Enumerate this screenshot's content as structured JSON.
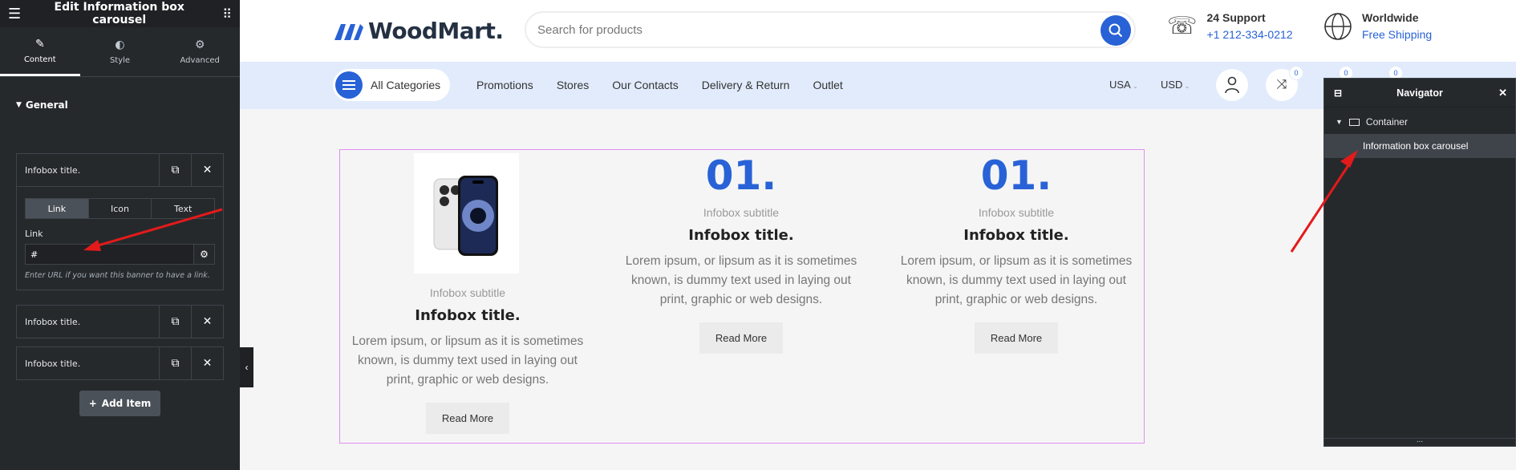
{
  "panel": {
    "title": "Edit Information box carousel",
    "tabs": [
      {
        "label": "Content"
      },
      {
        "label": "Style"
      },
      {
        "label": "Advanced"
      }
    ],
    "section": "General",
    "items": [
      {
        "label": "Infobox title."
      },
      {
        "label": "Infobox title."
      },
      {
        "label": "Infobox title."
      }
    ],
    "segments": [
      "Link",
      "Icon",
      "Text"
    ],
    "link_label": "Link",
    "link_value": "#",
    "link_hint": "Enter URL if you want this banner to have a link.",
    "add_item": "Add Item"
  },
  "site": {
    "logo": "WoodMart.",
    "search_placeholder": "Search for products",
    "support_title": "24 Support",
    "support_phone": "+1 212-334-0212",
    "ship_title": "Worldwide",
    "ship_sub": "Free Shipping",
    "all_categories": "All Categories",
    "nav": [
      "Promotions",
      "Stores",
      "Our Contacts",
      "Delivery & Return",
      "Outlet"
    ],
    "country": "USA",
    "currency": "USD",
    "badges": [
      "0",
      "0",
      "0"
    ],
    "accent": "#2862d6"
  },
  "cards": [
    {
      "subtitle": "Infobox subtitle",
      "title": "Infobox title.",
      "text": "Lorem ipsum, or lipsum as it is sometimes known, is dummy text used in laying out print, graphic or web designs.",
      "button": "Read More"
    },
    {
      "number": "01.",
      "subtitle": "Infobox subtitle",
      "title": "Infobox title.",
      "text": "Lorem ipsum, or lipsum as it is sometimes known, is dummy text used in laying out print, graphic or web designs.",
      "button": "Read More"
    },
    {
      "number": "01.",
      "subtitle": "Infobox subtitle",
      "title": "Infobox title.",
      "text": "Lorem ipsum, or lipsum as it is sometimes known, is dummy text used in laying out print, graphic or web designs.",
      "button": "Read More"
    }
  ],
  "navigator": {
    "title": "Navigator",
    "container": "Container",
    "selected": "Information box carousel",
    "more": "..."
  }
}
